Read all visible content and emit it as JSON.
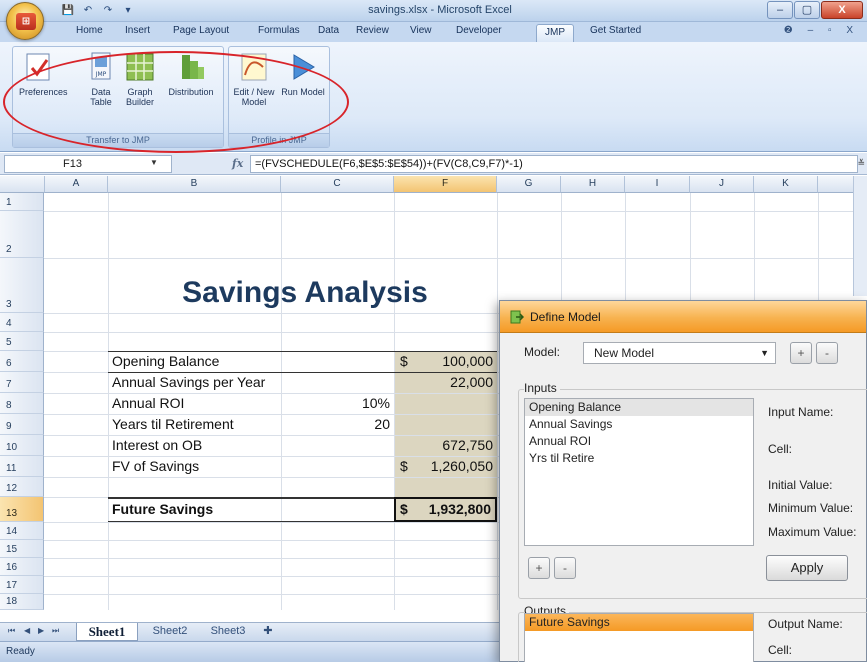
{
  "window": {
    "title": "savings.xlsx - Microsoft Excel",
    "office_button_label": "Office",
    "controls": {
      "minimize": "–",
      "maximize": "▢",
      "close": "X"
    }
  },
  "ribbon": {
    "tabs": [
      "Home",
      "Insert",
      "Page Layout",
      "Formulas",
      "Data",
      "Review",
      "View",
      "Developer",
      "JMP",
      "Get Started"
    ],
    "active_tab": "JMP",
    "right_controls": "❷ – ▫ X",
    "groups": [
      {
        "label": "Transfer to JMP",
        "buttons": [
          {
            "label": "Preferences",
            "icon": "preferences-icon"
          },
          {
            "label": "Data Table",
            "icon": "data-table-icon"
          },
          {
            "label": "Graph Builder",
            "icon": "graph-builder-icon"
          },
          {
            "label": "Distribution",
            "icon": "distribution-icon"
          }
        ]
      },
      {
        "label": "Profile in JMP",
        "buttons": [
          {
            "label": "Edit / New Model",
            "icon": "edit-model-icon"
          },
          {
            "label": "Run Model",
            "icon": "run-model-icon"
          }
        ]
      }
    ]
  },
  "formula_bar": {
    "name_box": "F13",
    "fx": "fx",
    "formula": "=(FVSCHEDULE(F6,$E$5:$E$54))+(FV(C8,C9,F7)*-1)"
  },
  "grid": {
    "columns": [
      "A",
      "B",
      "C",
      "F",
      "G",
      "H",
      "I",
      "J",
      "K"
    ],
    "selected_column": "F",
    "rows": [
      "1",
      "2",
      "3",
      "4",
      "5",
      "6",
      "7",
      "8",
      "9",
      "10",
      "11",
      "12",
      "13",
      "14",
      "15",
      "16",
      "17",
      "18"
    ],
    "selected_row": "13",
    "title": "Savings Analysis",
    "cells": {
      "b6": "Opening Balance",
      "f6_currency": "$",
      "f6": "100,000",
      "b7": "Annual Savings per Year",
      "f7": "22,000",
      "b8": "Annual ROI",
      "c8": "10%",
      "b9": "Years til Retirement",
      "c9": "20",
      "b10": "Interest on OB",
      "f10": "672,750",
      "b11": "FV of Savings",
      "f11_currency": "$",
      "f11": "1,260,050",
      "b13": "Future Savings",
      "f13_currency": "$",
      "f13": "1,932,800"
    }
  },
  "sheet_tabs": {
    "nav": [
      "⏮",
      "◀",
      "▶",
      "⏭"
    ],
    "tabs": [
      "Sheet1",
      "Sheet2",
      "Sheet3"
    ],
    "active": "Sheet1"
  },
  "status_bar": {
    "text": "Ready"
  },
  "dialog": {
    "title": "Define Model",
    "model_label": "Model:",
    "model_value": "New Model",
    "add_btn": "+",
    "remove_btn": "-",
    "inputs_label": "Inputs",
    "inputs": [
      "Opening Balance",
      "Annual Savings",
      "Annual ROI",
      "Yrs til Retire"
    ],
    "input_fields": {
      "input_name": "Input Name:",
      "cell": "Cell:",
      "initial_value": "Initial Value:",
      "minimum_value": "Minimum Value:",
      "maximum_value": "Maximum Value:"
    },
    "apply": "Apply",
    "outputs_label": "Outputs",
    "outputs": [
      "Future Savings"
    ],
    "output_fields": {
      "output_name": "Output Name:",
      "cell": "Cell:"
    }
  }
}
